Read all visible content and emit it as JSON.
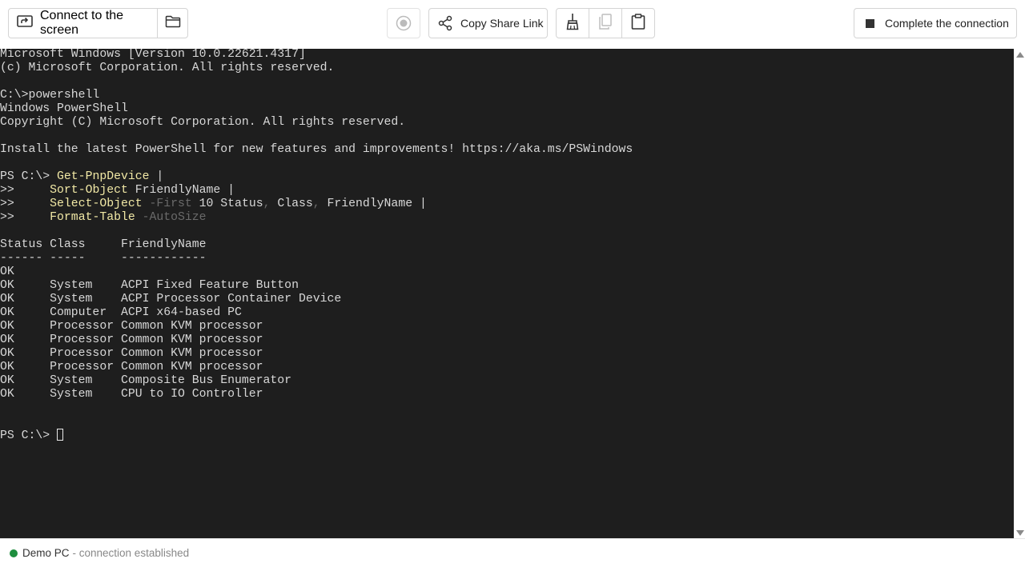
{
  "toolbar": {
    "connect_label": "Connect to the screen",
    "copy_share_label": "Copy Share Link",
    "complete_label": "Complete the connection"
  },
  "terminal": {
    "lines": [
      [
        {
          "t": "Microsoft Windows [Version 10.0.22621.4317]"
        }
      ],
      [
        {
          "t": "(c) Microsoft Corporation. All rights reserved."
        }
      ],
      [],
      [
        {
          "t": "C:\\>powershell"
        }
      ],
      [
        {
          "t": "Windows PowerShell"
        }
      ],
      [
        {
          "t": "Copyright (C) Microsoft Corporation. All rights reserved."
        }
      ],
      [],
      [
        {
          "t": "Install the latest PowerShell for new features and improvements! https://aka.ms/PSWindows"
        }
      ],
      [],
      [
        {
          "t": "PS C:\\> "
        },
        {
          "t": "Get-PnpDevice",
          "c": "y"
        },
        {
          "t": " |"
        }
      ],
      [
        {
          "t": ">>     "
        },
        {
          "t": "Sort-Object",
          "c": "y"
        },
        {
          "t": " FriendlyName |"
        }
      ],
      [
        {
          "t": ">>     "
        },
        {
          "t": "Select-Object",
          "c": "y"
        },
        {
          "t": " -First",
          "c": "g"
        },
        {
          "t": " 10 Status"
        },
        {
          "t": ",",
          "c": "g"
        },
        {
          "t": " Class"
        },
        {
          "t": ",",
          "c": "g"
        },
        {
          "t": " FriendlyName |"
        }
      ],
      [
        {
          "t": ">>     "
        },
        {
          "t": "Format-Table",
          "c": "y"
        },
        {
          "t": " -AutoSize",
          "c": "g"
        }
      ],
      [],
      [
        {
          "t": "Status Class     FriendlyName"
        }
      ],
      [
        {
          "t": "------ -----     ------------"
        }
      ],
      [
        {
          "t": "OK"
        }
      ],
      [
        {
          "t": "OK     System    ACPI Fixed Feature Button"
        }
      ],
      [
        {
          "t": "OK     System    ACPI Processor Container Device"
        }
      ],
      [
        {
          "t": "OK     Computer  ACPI x64-based PC"
        }
      ],
      [
        {
          "t": "OK     Processor Common KVM processor"
        }
      ],
      [
        {
          "t": "OK     Processor Common KVM processor"
        }
      ],
      [
        {
          "t": "OK     Processor Common KVM processor"
        }
      ],
      [
        {
          "t": "OK     Processor Common KVM processor"
        }
      ],
      [
        {
          "t": "OK     System    Composite Bus Enumerator"
        }
      ],
      [
        {
          "t": "OK     System    CPU to IO Controller"
        }
      ],
      [],
      [],
      [
        {
          "t": "PS C:\\> "
        }
      ]
    ]
  },
  "status": {
    "pc_name": "Demo PC",
    "connection_text": "- connection established",
    "indicator_color": "#1e8e3e"
  },
  "icons": {
    "connect": "screen-share-icon",
    "folder": "folder-icon",
    "record": "record-icon",
    "share": "share-icon",
    "clean": "broom-icon",
    "copy": "copy-icon",
    "paste": "clipboard-icon",
    "stop": "stop-icon"
  }
}
